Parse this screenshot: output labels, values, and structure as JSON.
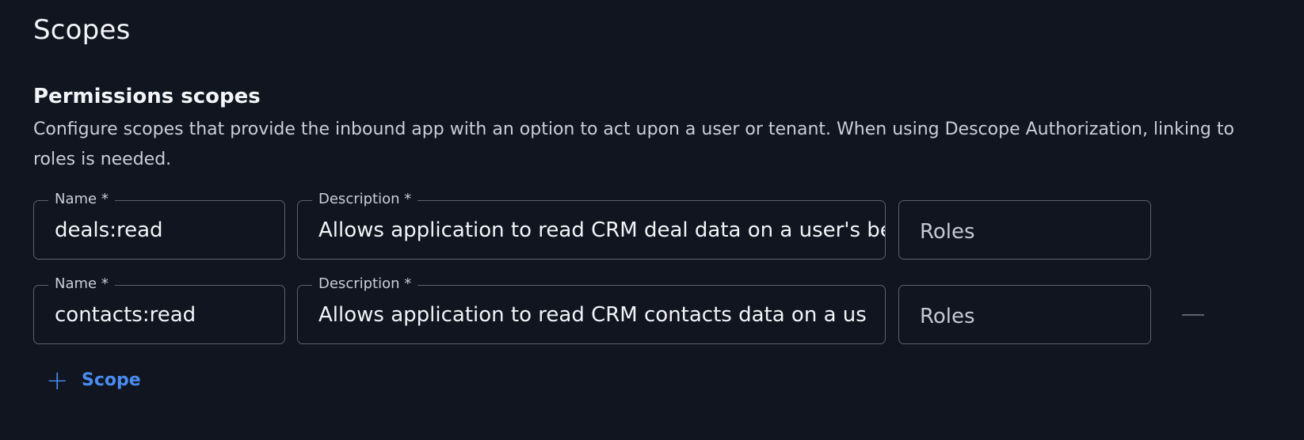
{
  "section": {
    "title": "Scopes"
  },
  "permissions": {
    "title": "Permissions scopes",
    "description": "Configure scopes that provide the inbound app with an option to act upon a user or tenant. When using Descope Authorization, linking to roles is needed."
  },
  "scopes": [
    {
      "name_label": "Name *",
      "name_value": "deals:read",
      "description_label": "Description *",
      "description_value": "Allows application to read CRM deal data on a user's behalf",
      "roles_placeholder": "Roles"
    },
    {
      "name_label": "Name *",
      "name_value": "contacts:read",
      "description_label": "Description *",
      "description_value": "Allows application to read CRM contacts data on a user's behalf",
      "roles_placeholder": "Roles"
    }
  ],
  "actions": {
    "add_scope_label": "Scope",
    "add_icon": "plus-icon",
    "remove_icon": "minus-icon"
  },
  "colors": {
    "background": "#10151f",
    "accent": "#4a8cf0",
    "border": "#5b6270"
  }
}
